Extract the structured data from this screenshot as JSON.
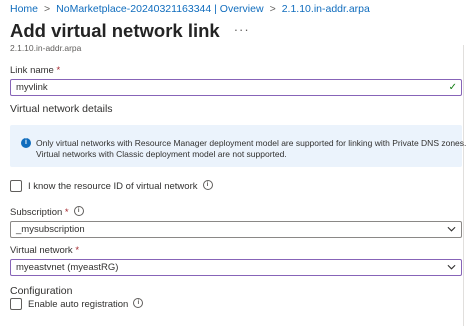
{
  "breadcrumb": {
    "items": [
      "Home",
      "NoMarketplace-20240321163344 | Overview",
      "2.1.10.in-addr.arpa"
    ],
    "separator": ">"
  },
  "header": {
    "title": "Add virtual network link",
    "subtitle": "2.1.10.in-addr.arpa",
    "more_icon": "ellipsis-icon"
  },
  "link_name": {
    "label": "Link name",
    "required_marker": "*",
    "value": "myvlink"
  },
  "vnet_details": {
    "heading": "Virtual network details",
    "info_line1": "Only virtual networks with Resource Manager deployment model are supported for linking with Private DNS zones.",
    "info_line2": "Virtual networks with Classic deployment model are not supported."
  },
  "know_resource_id": {
    "label": "I know the resource ID of virtual network",
    "checked": false
  },
  "subscription": {
    "label": "Subscription",
    "required_marker": "*",
    "value": "_mysubscription"
  },
  "virtual_network": {
    "label": "Virtual network",
    "required_marker": "*",
    "value": "myeastvnet (myeastRG)"
  },
  "configuration": {
    "heading": "Configuration",
    "auto_registration_label": "Enable auto registration",
    "auto_registration_checked": false
  },
  "colors": {
    "link": "#0f6cbd",
    "valid_border": "#8764b8",
    "info_background": "#ebf3fc",
    "success": "#107c10",
    "required": "#a4262c"
  }
}
